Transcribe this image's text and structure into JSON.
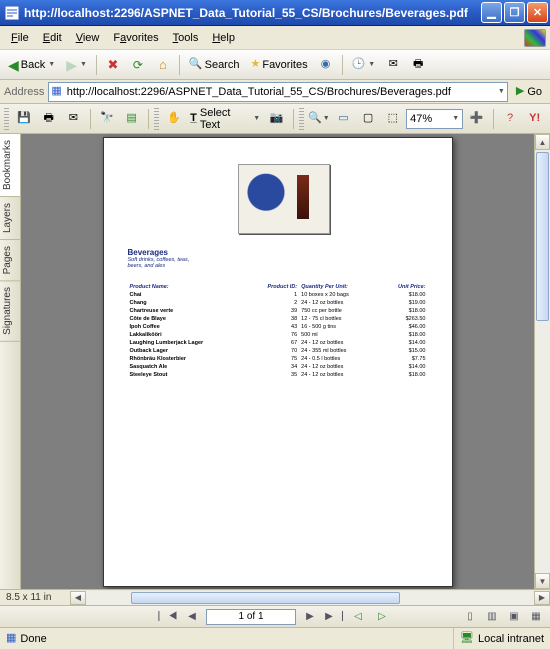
{
  "window": {
    "title": "http://localhost:2296/ASPNET_Data_Tutorial_55_CS/Brochures/Beverages.pdf"
  },
  "menu": {
    "file": "File",
    "edit": "Edit",
    "view": "View",
    "favorites": "Favorites",
    "tools": "Tools",
    "help": "Help"
  },
  "nav": {
    "back": "Back",
    "search": "Search",
    "favorites": "Favorites"
  },
  "address": {
    "label": "Address",
    "url": "http://localhost:2296/ASPNET_Data_Tutorial_55_CS/Brochures/Beverages.pdf",
    "go": "Go"
  },
  "pdfToolbar": {
    "selectText": "Select Text",
    "zoom": "47%"
  },
  "sidebar": {
    "tabs": [
      "Bookmarks",
      "Layers",
      "Pages",
      "Signatures"
    ]
  },
  "page": {
    "dimensions": "8.5 x 11 in",
    "pager": "1 of 1"
  },
  "status": {
    "done": "Done",
    "zone": "Local intranet"
  },
  "document": {
    "title": "Beverages",
    "subtitle": "Soft drinks, coffees, teas, beers, and ales",
    "columns": {
      "name": "Product Name:",
      "id": "Product ID:",
      "qty": "Quantity Per Unit:",
      "price": "Unit Price:"
    },
    "rows": [
      {
        "name": "Chai",
        "id": "1",
        "qty": "10 boxes x 20 bags",
        "price": "$18.00"
      },
      {
        "name": "Chang",
        "id": "2",
        "qty": "24 - 12 oz bottles",
        "price": "$19.00"
      },
      {
        "name": "Chartreuse verte",
        "id": "39",
        "qty": "750 cc per bottle",
        "price": "$18.00"
      },
      {
        "name": "Côte de Blaye",
        "id": "38",
        "qty": "12 - 75 cl bottles",
        "price": "$263.50"
      },
      {
        "name": "Ipoh Coffee",
        "id": "43",
        "qty": "16 - 500 g tins",
        "price": "$46.00"
      },
      {
        "name": "Lakkalikööri",
        "id": "76",
        "qty": "500 ml",
        "price": "$18.00"
      },
      {
        "name": "Laughing Lumberjack Lager",
        "id": "67",
        "qty": "24 - 12 oz bottles",
        "price": "$14.00"
      },
      {
        "name": "Outback Lager",
        "id": "70",
        "qty": "24 - 355 ml bottles",
        "price": "$15.00"
      },
      {
        "name": "Rhönbräu Klosterbier",
        "id": "75",
        "qty": "24 - 0.5 l bottles",
        "price": "$7.75"
      },
      {
        "name": "Sasquatch Ale",
        "id": "34",
        "qty": "24 - 12 oz bottles",
        "price": "$14.00"
      },
      {
        "name": "Steeleye Stout",
        "id": "35",
        "qty": "24 - 12 oz bottles",
        "price": "$18.00"
      }
    ]
  },
  "colors": {
    "accent": "#1a2a80"
  }
}
